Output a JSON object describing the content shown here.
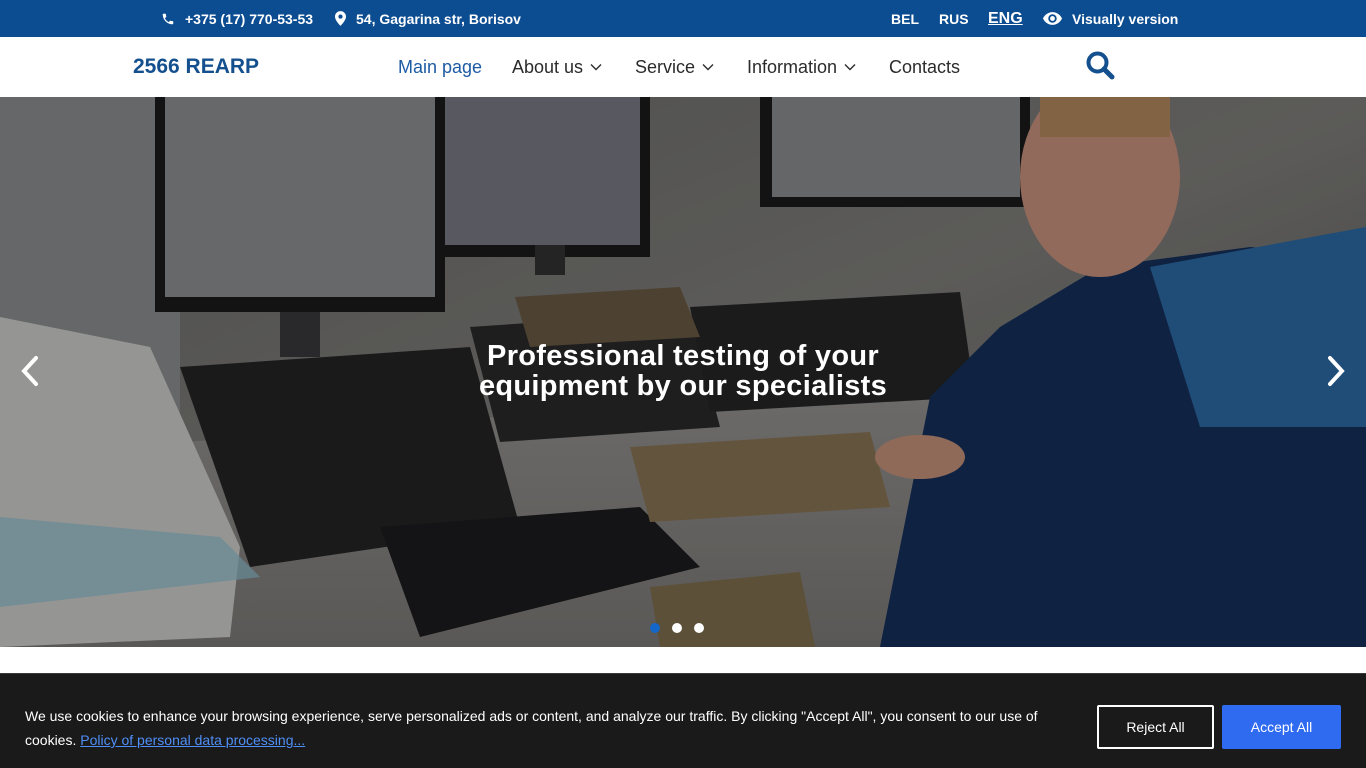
{
  "topbar": {
    "phone": "+375 (17) 770-53-53",
    "address": "54, Gagarina str, Borisov",
    "languages": [
      "BEL",
      "RUS",
      "ENG"
    ],
    "active_language": "ENG",
    "visually_version": "Visually version",
    "background_color": "#0c4c91"
  },
  "header": {
    "logo": "2566 REARP",
    "nav": [
      {
        "label": "Main page",
        "active": true,
        "dropdown": false
      },
      {
        "label": "About us",
        "active": false,
        "dropdown": true
      },
      {
        "label": "Service",
        "active": false,
        "dropdown": true
      },
      {
        "label": "Information",
        "active": false,
        "dropdown": true
      },
      {
        "label": "Contacts",
        "active": false,
        "dropdown": false
      }
    ],
    "search_icon": "search-icon"
  },
  "hero": {
    "title_line1": "Professional testing of your",
    "title_line2": "equipment by our specialists",
    "slides_count": 3,
    "active_slide": 1
  },
  "cookie": {
    "text": "We use cookies to enhance your browsing experience, serve personalized ads or content, and analyze our traffic. By clicking \"Accept All\", you consent to our use of cookies.",
    "link_text": "Policy of personal data processing...",
    "reject_label": "Reject All",
    "accept_label": "Accept All",
    "accept_color": "#2f6bf0"
  }
}
